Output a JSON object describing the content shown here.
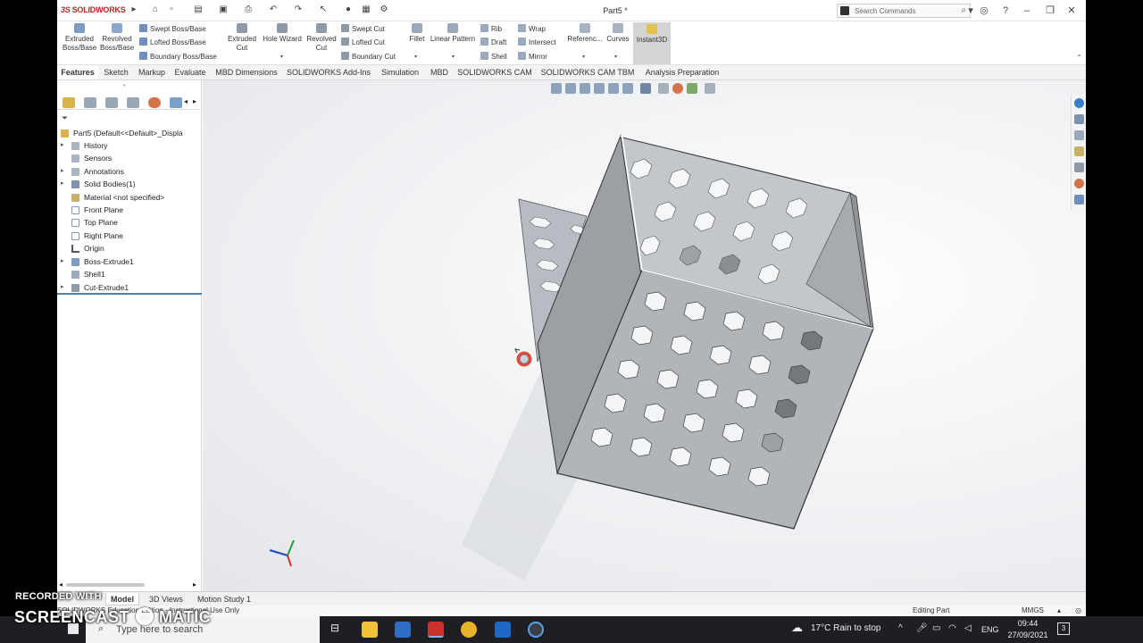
{
  "titlebar": {
    "app_logo": "SOLIDWORKS",
    "doc_title": "Part5 *",
    "search_placeholder": "Search Commands"
  },
  "command_manager": {
    "extruded_boss": "Extruded Boss/Base",
    "revolved_boss": "Revolved Boss/Base",
    "swept_boss": "Swept Boss/Base",
    "lofted_boss": "Lofted Boss/Base",
    "boundary_boss": "Boundary Boss/Base",
    "extruded_cut": "Extruded Cut",
    "hole_wizard": "Hole Wizard",
    "revolved_cut": "Revolved Cut",
    "swept_cut": "Swept Cut",
    "lofted_cut": "Lofted Cut",
    "boundary_cut": "Boundary Cut",
    "fillet": "Fillet",
    "linear_pattern": "Linear Pattern",
    "rib": "Rib",
    "draft": "Draft",
    "shell": "Shell",
    "wrap": "Wrap",
    "intersect": "Intersect",
    "mirror": "Mirror",
    "reference": "Referenc...",
    "curves": "Curves",
    "instant3d": "Instant3D"
  },
  "tabs": [
    "Features",
    "Sketch",
    "Markup",
    "Evaluate",
    "MBD Dimensions",
    "SOLIDWORKS Add-Ins",
    "Simulation",
    "MBD",
    "SOLIDWORKS CAM",
    "SOLIDWORKS CAM TBM",
    "Analysis Preparation"
  ],
  "tree": {
    "root": "Part5  (Default<<Default>_Displa",
    "items": [
      "History",
      "Sensors",
      "Annotations",
      "Solid Bodies(1)",
      "Material <not specified>",
      "Front Plane",
      "Top Plane",
      "Right Plane",
      "Origin",
      "Boss-Extrude1",
      "Shell1",
      "Cut-Extrude1"
    ]
  },
  "bottom_tabs": [
    "Model",
    "3D Views",
    "Motion Study 1"
  ],
  "status": {
    "edition": "SOLIDWORKS Education Edition - Instructional Use Only",
    "mode": "Editing Part",
    "units": "MMGS"
  },
  "taskbar": {
    "search_placeholder": "Type here to search",
    "weather": "17°C  Rain to stop",
    "lang": "ENG",
    "time": "09:44",
    "date": "27/09/2021",
    "notif_count": "3"
  },
  "watermark": {
    "line1": "RECORDED WITH",
    "line2": "SCREENCAST",
    "line3": "MATIC"
  },
  "colors": {
    "accent": "#3a84c4",
    "brand": "#d02020",
    "taskbar": "#1d1f24"
  }
}
